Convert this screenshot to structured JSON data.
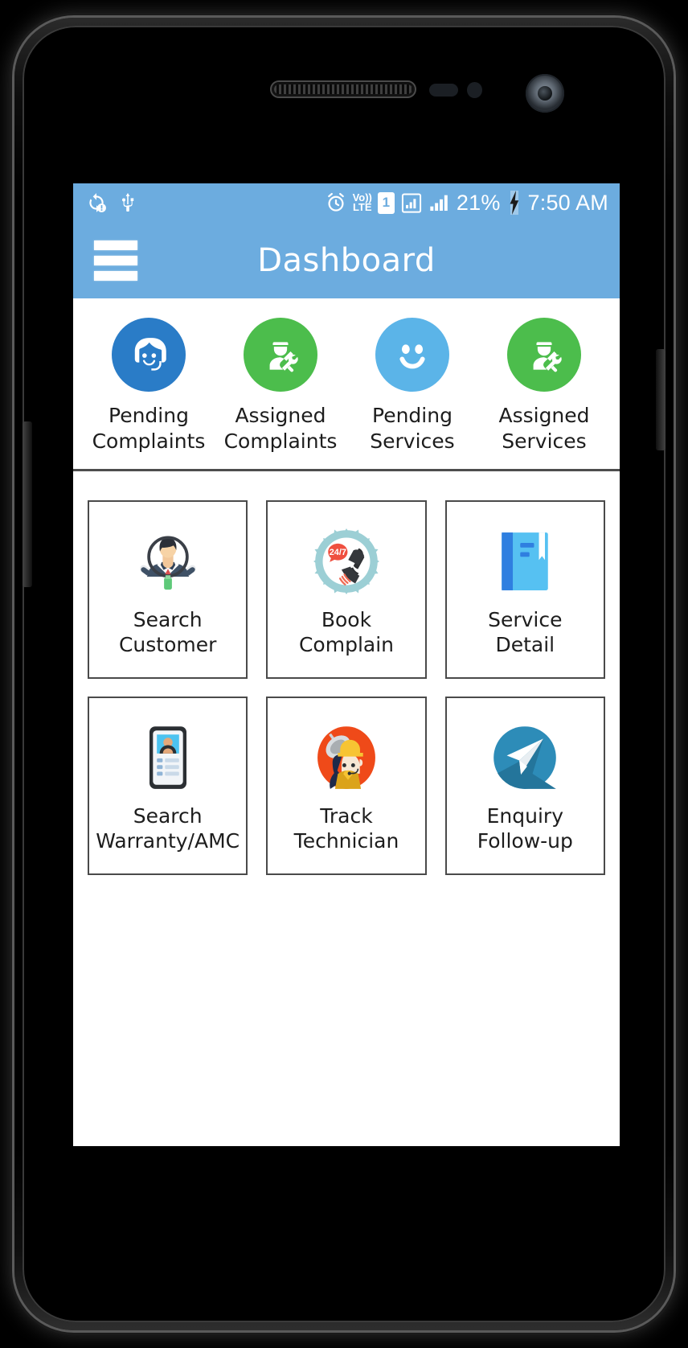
{
  "status_bar": {
    "left_icons": [
      "sync-problem-icon",
      "usb-icon"
    ],
    "alarm_icon": "alarm-icon",
    "network_type": "Vo))\nLTE",
    "network_type_line1": "Vo))",
    "network_type_line2": "LTE",
    "sim_label": "1",
    "signal_icons": [
      "signal-sim1-icon",
      "signal-sim2-icon"
    ],
    "battery_percent": "21%",
    "charging_icon": "charging-bolt-icon",
    "time": "7:50 AM"
  },
  "app_bar": {
    "menu_icon": "hamburger-menu-icon",
    "title": "Dashboard"
  },
  "stats": [
    {
      "label": "Pending\nComplaints",
      "icon": "headset-agent-icon",
      "color": "#2a7cc7"
    },
    {
      "label": "Assigned\nComplaints",
      "icon": "technician-tools-icon",
      "color": "#4cbd4c"
    },
    {
      "label": "Pending\nServices",
      "icon": "smiley-face-icon",
      "color": "#5bb4e8"
    },
    {
      "label": "Assigned\nServices",
      "icon": "technician-tools-icon",
      "color": "#4cbd4c"
    }
  ],
  "tiles": [
    {
      "label": "Search\nCustomer",
      "icon": "magnifier-businessman-icon"
    },
    {
      "label": "Book\nComplain",
      "icon": "24-7-phone-support-icon"
    },
    {
      "label": "Service\nDetail",
      "icon": "blue-book-bookmark-icon"
    },
    {
      "label": "Search\nWarranty/AMC",
      "icon": "id-card-icon"
    },
    {
      "label": "Track\nTechnician",
      "icon": "satellite-technician-icon"
    },
    {
      "label": "Enquiry\nFollow-up",
      "icon": "paper-plane-send-icon"
    }
  ],
  "colors": {
    "app_bar": "#6cacdf",
    "screen_background": "#ffffff",
    "tile_border": "#4a4a4a",
    "text": "#1d1d1d"
  }
}
